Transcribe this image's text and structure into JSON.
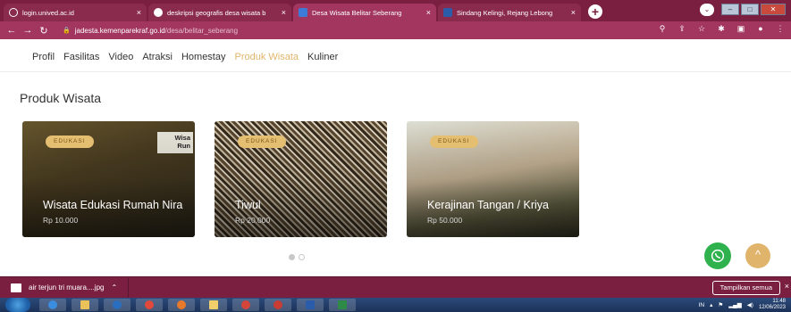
{
  "browser": {
    "tabs": [
      {
        "title": "login.unived.ac.id",
        "icon": "globe-icon",
        "active": false
      },
      {
        "title": "deskripsi geografis desa wisata b",
        "icon": "chrome-search-icon",
        "active": false
      },
      {
        "title": "Desa Wisata Belitar Seberang",
        "icon": "site-logo-icon",
        "active": true
      },
      {
        "title": "Sindang Kelingi, Rejang Lebong",
        "icon": "word-doc-icon",
        "active": false
      }
    ],
    "close_glyph": "×",
    "new_tab_glyph": "+",
    "url_host": "jadesta.kemenparekraf.go.id",
    "url_path": "/desa/belitar_seberang"
  },
  "site": {
    "nav": [
      {
        "label": "Profil",
        "active": false
      },
      {
        "label": "Fasilitas",
        "active": false
      },
      {
        "label": "Video",
        "active": false
      },
      {
        "label": "Atraksi",
        "active": false
      },
      {
        "label": "Homestay",
        "active": false
      },
      {
        "label": "Produk Wisata",
        "active": true
      },
      {
        "label": "Kuliner",
        "active": false
      }
    ],
    "section_title": "Produk Wisata",
    "cards": [
      {
        "badge": "EDUKASI",
        "title": "Wisata Edukasi Rumah Nira",
        "price": "Rp 10.000",
        "sign": "Wisa\nRun"
      },
      {
        "badge": "EDUKASI",
        "title": "Tiwul",
        "price": "Rp 20.000"
      },
      {
        "badge": "EDUKASI",
        "title": "Kerajinan Tangan / Kriya",
        "price": "Rp 50.000"
      }
    ],
    "carousel_pages": 2,
    "carousel_active": 1,
    "to_top_glyph": "^"
  },
  "downloads": {
    "file_name": "air terjun tri muara....jpg",
    "show_all_label": "Tampilkan semua",
    "close_glyph": "×"
  },
  "taskbar": {
    "lang": "IN",
    "time": "11:48",
    "date": "12/06/2023"
  },
  "colors": {
    "brand": "#7a1f3f",
    "accent": "#e0b56b",
    "whatsapp": "#2fb24e"
  }
}
